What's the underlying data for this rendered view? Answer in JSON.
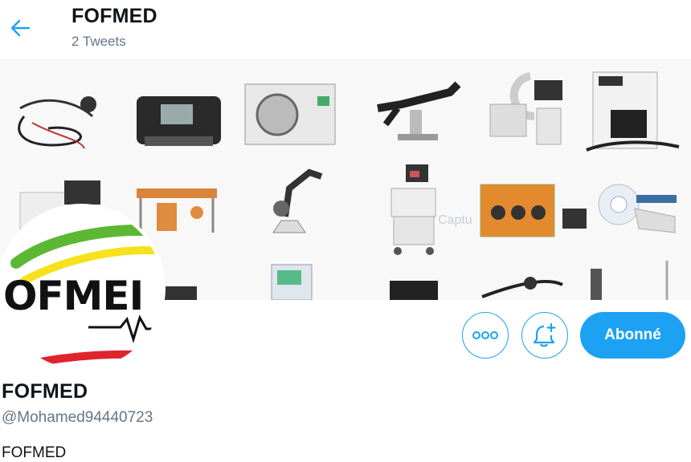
{
  "header": {
    "title": "FOFMED",
    "tweet_count": "2 Tweets"
  },
  "banner": {
    "watermark": "Captu"
  },
  "avatar": {
    "logo_text": "OFMEI"
  },
  "actions": {
    "follow_label": "Abonné"
  },
  "profile": {
    "name": "FOFMED",
    "handle": "@Mohamed94440723",
    "bio": "FOFMED"
  },
  "colors": {
    "accent": "#1da1f2",
    "text_primary": "#0f1419",
    "text_secondary": "#657786",
    "logo_green": "#5cb833",
    "logo_yellow": "#f5e21c",
    "logo_red": "#e0242d"
  }
}
